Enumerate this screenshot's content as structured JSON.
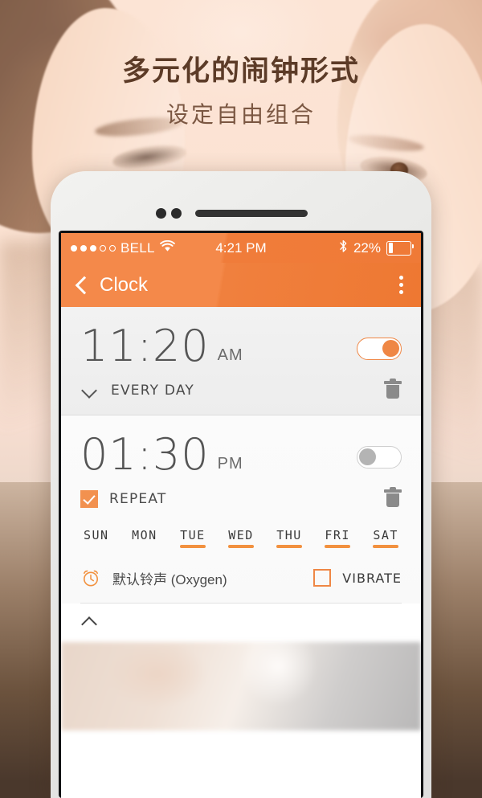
{
  "poster": {
    "headline": "多元化的闹钟形式",
    "subhead": "设定自由组合",
    "headline_color": "#5c3b27",
    "subhead_color": "#7b5742"
  },
  "phone": {
    "status_bar": {
      "signal_filled": 3,
      "signal_empty": 2,
      "carrier": "BELL",
      "wifi_icon": "wifi-icon",
      "time": "4:21 PM",
      "bluetooth_icon": "bluetooth-icon",
      "battery_percent": "22%",
      "battery_level": 22
    },
    "app_bar": {
      "back_icon": "back-chevron-icon",
      "title": "Clock",
      "overflow_icon": "kebab-menu-icon"
    },
    "alarms": [
      {
        "time": "11:20",
        "meridiem": "AM",
        "enabled": true,
        "expanded": false,
        "schedule_label": "EVERY DAY",
        "expand_icon": "chevron-down-icon",
        "delete_icon": "trash-icon"
      },
      {
        "time": "01:30",
        "meridiem": "PM",
        "enabled": false,
        "expanded": true,
        "repeat_label": "REPEAT",
        "repeat_checked": true,
        "delete_icon": "trash-icon",
        "days": [
          {
            "label": "SUN",
            "selected": false
          },
          {
            "label": "MON",
            "selected": false
          },
          {
            "label": "TUE",
            "selected": true
          },
          {
            "label": "WED",
            "selected": true
          },
          {
            "label": "THU",
            "selected": true
          },
          {
            "label": "FRI",
            "selected": true
          },
          {
            "label": "SAT",
            "selected": true
          }
        ],
        "ringtone_icon": "alarm-clock-icon",
        "ringtone_label": "默认铃声 (Oxygen)",
        "vibrate_label": "VIBRATE",
        "vibrate_checked": false,
        "collapse_icon": "chevron-up-icon"
      }
    ]
  },
  "colors": {
    "accent_orange": "#f2913f",
    "header_orange": "#f4894a",
    "toggle_on": "#ef8745",
    "toggle_off": "#b4b4b4",
    "checkbox_orange": "#f2914f"
  }
}
